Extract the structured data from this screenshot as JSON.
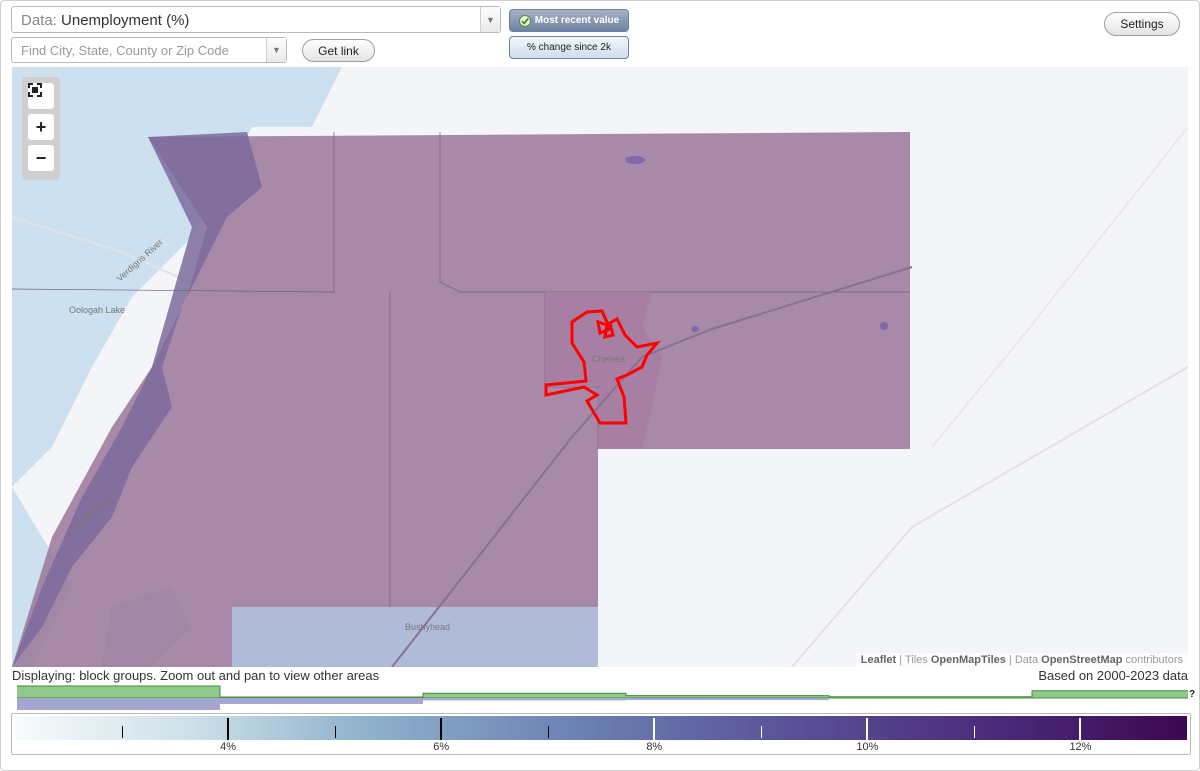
{
  "data_select": {
    "prefix": "Data:",
    "value": "Unemployment (%)"
  },
  "search": {
    "placeholder": "Find City, State, County or Zip Code"
  },
  "buttons": {
    "get_link": "Get link",
    "settings": "Settings"
  },
  "modes": {
    "recent": "Most recent value",
    "change": "% change since 2k",
    "selected": "recent"
  },
  "map": {
    "labels": {
      "chelsea": "Chelsea",
      "bushyhead": "Bushyhead",
      "oologah_lake": "Oologah Lake",
      "verdigris_river": "Verdigris River"
    },
    "attribution": {
      "leaflet": "Leaflet",
      "tiles_label": "Tiles",
      "tiles": "OpenMapTiles",
      "data_label": "Data",
      "data": "OpenStreetMap",
      "contributors": "contributors"
    },
    "zoom": {
      "zoom_in": "+",
      "zoom_out": "−",
      "fullscreen_icon": "fullscreen-icon"
    },
    "colors": {
      "water": "#cce0f0",
      "region_fill": "#8a5f8a",
      "selected_outline": "#ff0000",
      "low_fill": "#a9b6d3"
    }
  },
  "status": {
    "displaying": "Displaying: block groups. Zoom out and pan to view other areas",
    "based_on": "Based on 2000-2023 data"
  },
  "histogram": {
    "help": "?",
    "green_bins": [
      1.0,
      0,
      0.4,
      0.2,
      0.1,
      0.6
    ],
    "purple_bins": [
      1.0,
      0.5,
      0.2,
      0.1,
      0,
      0
    ],
    "colors": {
      "green": "#90c98a",
      "purple": "#a6a6d2"
    }
  },
  "legend": {
    "min": 2,
    "max": 13,
    "ticks": [
      3,
      4,
      5,
      6,
      7,
      8,
      9,
      10,
      11,
      12
    ],
    "major_ticks": [
      4,
      6,
      8,
      10,
      12
    ],
    "labels": [
      "4%",
      "6%",
      "8%",
      "10%",
      "12%"
    ]
  }
}
